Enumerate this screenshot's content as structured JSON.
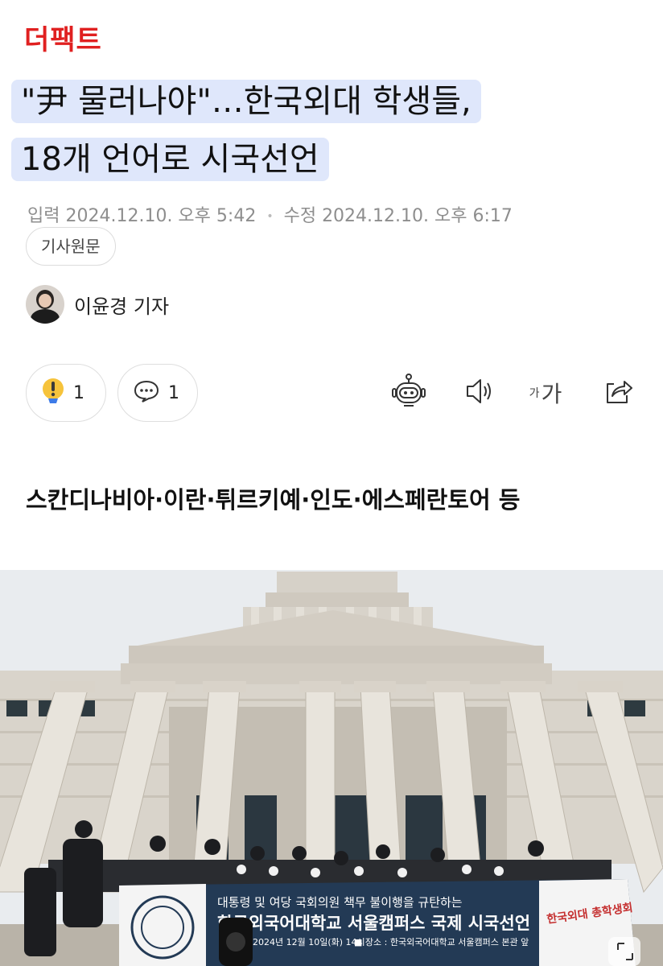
{
  "press": {
    "name": "더팩트"
  },
  "article": {
    "title_line1": "\"尹 물러나야\"…한국외대 학생들,",
    "title_line2": "18개 언어로 시국선언",
    "input_label": "입력",
    "input_time": "2024.12.10. 오후 5:42",
    "modified_label": "수정",
    "modified_time": "2024.12.10. 오후 6:17",
    "origin_button": "기사원문",
    "author": "이윤경 기자",
    "subtitle": "스칸디나비아·이란·튀르키예·인도·에스페란토어 등"
  },
  "reactions": [
    {
      "icon": "exclamation-reaction-icon",
      "count": "1"
    },
    {
      "icon": "comment-icon",
      "count": "1"
    }
  ],
  "toolbar": {
    "summary_icon": "robot-summary-icon",
    "audio_icon": "speaker-icon",
    "font_small": "가",
    "font_large": "가",
    "share_icon": "share-icon"
  },
  "photo": {
    "banner_line1": "대통령 및 여당 국회의원 책무 불이행을 규탄하는",
    "banner_line2": "한국외국어대학교 서울캠퍼스 국제 시국선언",
    "banner_line3": "2024년 12월 10일(화) 14시",
    "banner_place": "■ 장소 : 한국외국어대학교 서울캠퍼스 본관 앞",
    "banner_right": "한국외대 총학생회",
    "colors": {
      "sky": "#e9ecef",
      "stone": "#d9d4cb",
      "banner": "#233a55"
    }
  }
}
